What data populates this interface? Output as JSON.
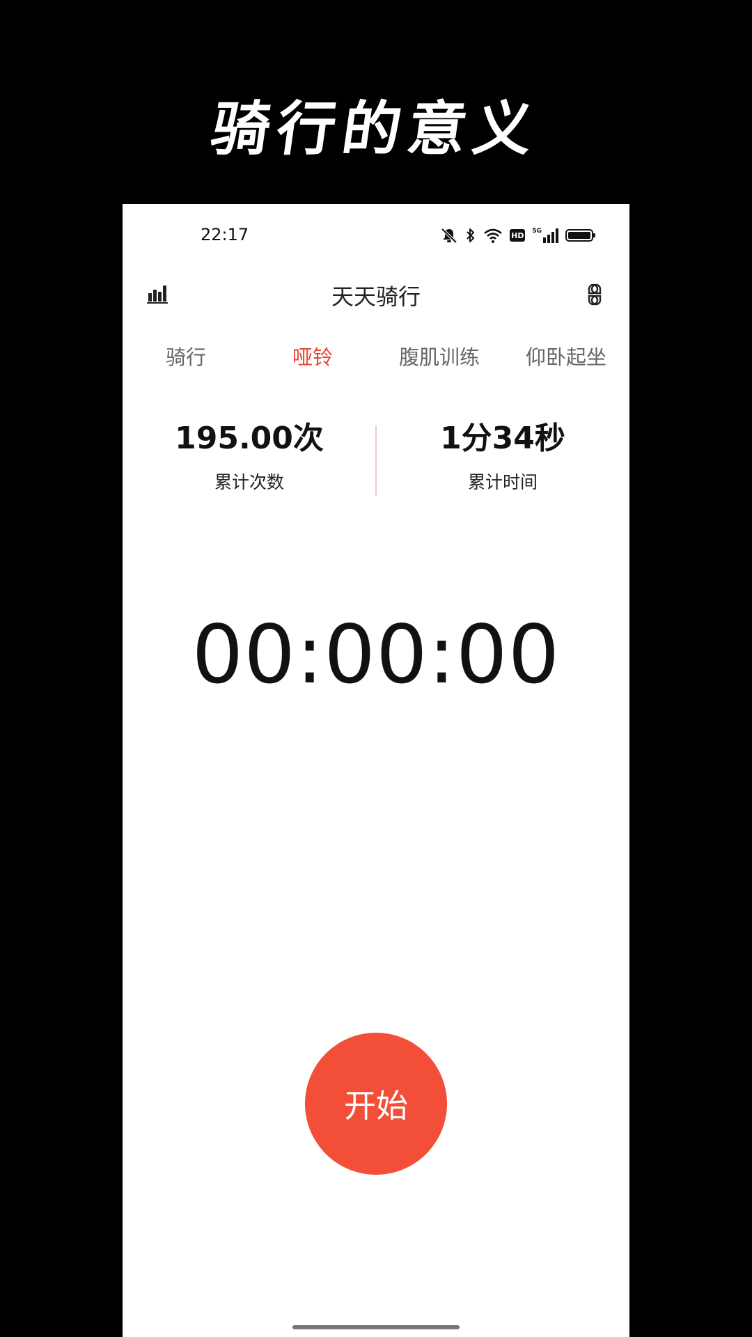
{
  "promo": {
    "title": "骑行的意义"
  },
  "status_bar": {
    "time": "22:17",
    "icons": [
      "mute-icon",
      "bluetooth-icon",
      "wifi-icon",
      "hd-icon",
      "5g-signal-icon",
      "battery-icon"
    ],
    "hd_label": "HD",
    "network_label": "5G",
    "battery_level": 1.0
  },
  "app_bar": {
    "title": "天天骑行",
    "left_icon": "stats-chart-icon",
    "right_icon": "grid-menu-icon"
  },
  "tabs": [
    {
      "label": "骑行",
      "active": false
    },
    {
      "label": "哑铃",
      "active": true
    },
    {
      "label": "腹肌训练",
      "active": false
    },
    {
      "label": "仰卧起坐",
      "active": false
    }
  ],
  "stats": {
    "count_value": "195.00次",
    "count_label": "累计次数",
    "time_value": "1分34秒",
    "time_label": "累计时间"
  },
  "timer": {
    "display": "00:00:00"
  },
  "start_button": {
    "label": "开始"
  },
  "colors": {
    "accent": "#f24e38",
    "tab_active": "#e8452f",
    "divider": "#f0c8c8",
    "background": "#ffffff",
    "frame": "#000000"
  }
}
